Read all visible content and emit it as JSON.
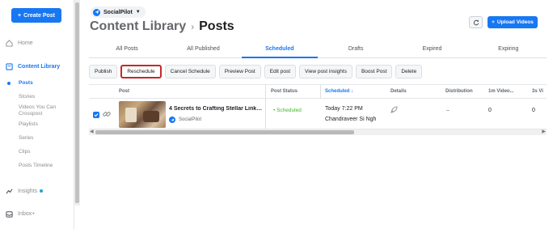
{
  "sidebar": {
    "create_label": "Create Post",
    "items": {
      "home": "Home",
      "content_library": "Content Library",
      "insights": "Insights",
      "inbox": "Inbox+"
    },
    "sub_items": {
      "posts": "Posts",
      "stories": "Stories",
      "videos_crosspost_1": "Videos You Can",
      "videos_crosspost_2": "Crosspost",
      "playlists": "Playlists",
      "series": "Series",
      "clips": "Clips",
      "posts_timeline": "Posts Timeline"
    }
  },
  "account": {
    "name": "SocialPilot"
  },
  "header": {
    "crumb": "Content Library",
    "separator": "›",
    "current": "Posts",
    "upload_label": "Upload Videos"
  },
  "tabs": [
    "All Posts",
    "All Published",
    "Scheduled",
    "Drafts",
    "Expired",
    "Expiring"
  ],
  "active_tab": "Scheduled",
  "actions": [
    "Publish",
    "Reschedule",
    "Cancel Schedule",
    "Preview Post",
    "Edit post",
    "View post insights",
    "Boost Post",
    "Delete"
  ],
  "columns": {
    "post": "Post",
    "post_status": "Post Status",
    "scheduled": "Scheduled ↓",
    "details": "Details",
    "distribution": "Distribution",
    "views_1m": "1m Video...",
    "views_3s": "3s Vi"
  },
  "rows": [
    {
      "title": "4 Secrets to Crafting Stellar LinkedIn ...",
      "source": "SocialPilot",
      "status": "Scheduled",
      "scheduled_time": "Today 7:22 PM",
      "scheduled_by": "Chandraveer Si Ngh",
      "distribution": "–",
      "views_1m": "0",
      "views_3s": "0"
    }
  ],
  "colors": {
    "accent": "#1877f2",
    "scheduled_green": "#42b72a",
    "highlight_red": "#c62828"
  }
}
